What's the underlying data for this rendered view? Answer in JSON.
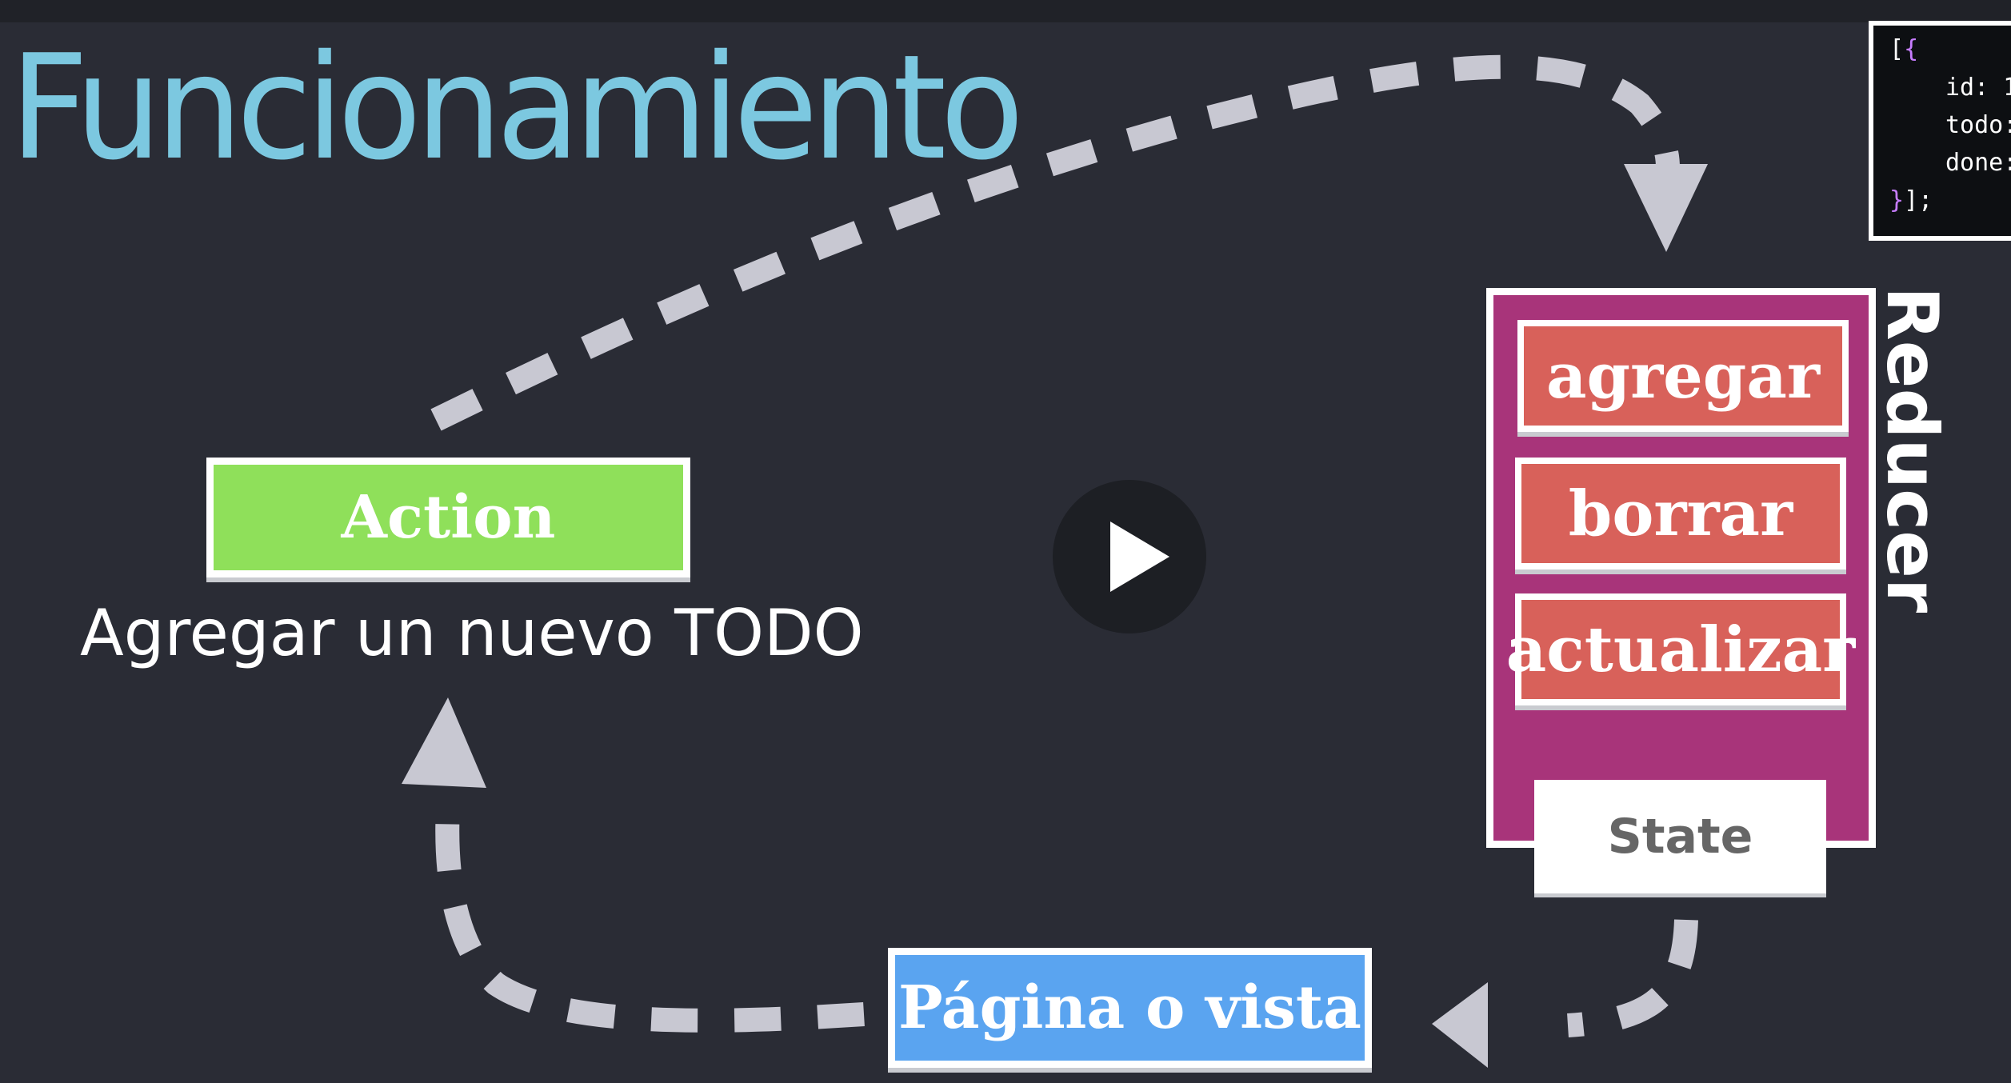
{
  "slide": {
    "title": "Funcionamiento",
    "action_label": "Action",
    "action_description": "Agregar un nuevo TODO",
    "reducer_label": "Reducer",
    "reducer_actions": [
      "agregar",
      "borrar",
      "actualizar"
    ],
    "state_label": "State",
    "view_label": "Página o vista"
  },
  "code_snippet": {
    "line1_bracket": "[",
    "line1_brace": "{",
    "line2": "id: 1",
    "line3": "todo:",
    "line4": "done:",
    "line5_brace": "}",
    "line5_rest": "];"
  },
  "player": {
    "play_icon": "play-icon"
  },
  "colors": {
    "background": "#2a2c35",
    "title": "#7cc8e0",
    "action": "#8fe05a",
    "reducer": "#a8347a",
    "reducer_button": "#d8615a",
    "view": "#5aa4f0",
    "arrow": "#c8c8d2"
  }
}
